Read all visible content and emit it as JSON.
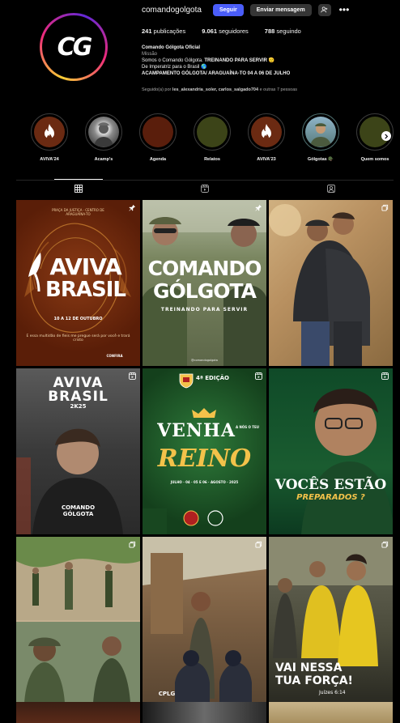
{
  "profile": {
    "username": "comandogolgota",
    "follow_label": "Seguir",
    "message_label": "Enviar mensagem",
    "suggest_icon": "+♟",
    "more_icon": "•••",
    "avatar_text": "CG",
    "stats": {
      "posts_count": "241",
      "posts_label": "publicações",
      "followers_count": "9.061",
      "followers_label": "seguidores",
      "following_count": "788",
      "following_label": "seguindo"
    },
    "bio": {
      "name": "Comando Gólgota Oficial",
      "category": "Missão",
      "line1_a": "Somos o Comando Gólgota. ",
      "line1_b": "TREINANDO PARA SERVIR",
      "line1_emoji": "🫡",
      "line2": "De Imperatriz para o Brasil 🌎",
      "line3": "ACAMPAMENTO GÓLGOTA/ ARAGUAÍNA-TO 04 A 06 DE JULHO"
    },
    "followed_by": {
      "prefix": "Seguido(a) por",
      "names": "les_alexandria_soler, carlos_salgado704",
      "suffix": "e outras 7 pessoas"
    }
  },
  "highlights": [
    {
      "label": "AVIVA'24",
      "icon": "flame-icon",
      "color": "#6b2a12"
    },
    {
      "label": "Acamp's",
      "icon": "photo",
      "color": "#7d7d7d"
    },
    {
      "label": "Agenda",
      "icon": "none",
      "color": "#5a1e0c"
    },
    {
      "label": "Relatos",
      "icon": "none",
      "color": "#3c4418"
    },
    {
      "label": "AVIVA'23",
      "icon": "flame-icon",
      "color": "#6b2a12"
    },
    {
      "label": "Gólgotas 🪖",
      "icon": "photo",
      "color": "#567a7a"
    },
    {
      "label": "Quem somos",
      "icon": "none",
      "color": "#3c4418"
    }
  ],
  "tabs": [
    {
      "name": "tab-posts",
      "icon": "grid-icon"
    },
    {
      "name": "tab-reels",
      "icon": "reels-icon"
    },
    {
      "name": "tab-tagged",
      "icon": "tagged-icon"
    }
  ],
  "posts": {
    "p1": {
      "badge": "pin-icon",
      "top_small": "PRAÇA DA JUSTIÇA · CENTRO DE ARAGUAÍNA-TO",
      "title1": "AVIVA",
      "title2": "BRASIL",
      "dates": "10 A 12 DE OUTUBRO",
      "caption": "E essa multidão de fieis me pregue será por você e trará cristo",
      "tag": "CONFIRA"
    },
    "p2": {
      "badge": "pin-icon",
      "title1": "COMANDO",
      "title2": "GÓLGOTA",
      "subtitle": "TREINANDO PARA SERVIR",
      "handle": "@comandogolgota"
    },
    "p3": {
      "badge": "carousel-icon"
    },
    "p4": {
      "badge": "reel-icon",
      "title1": "AVIVA",
      "title2": "BRASIL",
      "sub": "2K25",
      "shirt": "COMANDO GÓLGOTA"
    },
    "p5": {
      "badge": "reel-icon",
      "edition": "4ª EDIÇÃO",
      "word1": "VENHA",
      "word2": "REINO",
      "small": "A NÓS O TEU",
      "dates": "JULHO · 04 · 05 E 06 · AGOSTO · 2025"
    },
    "p6": {
      "badge": "reel-icon",
      "title": "VOCÊS ESTÃO",
      "sub": "PREPARADOS ?"
    },
    "p7": {
      "badge": "carousel-icon"
    },
    "p8": {
      "badge": "carousel-icon",
      "shirt": "CPLG"
    },
    "p9": {
      "badge": "carousel-icon",
      "line1": "VAI NESSA",
      "line2": "TUA FORÇA!",
      "verse": "Juízes 6:14"
    }
  },
  "colors": {
    "follow_blue": "#4a5df9",
    "button_gray": "#363636",
    "gold": "#f3c24a",
    "green_dark": "#1f5a2a"
  }
}
